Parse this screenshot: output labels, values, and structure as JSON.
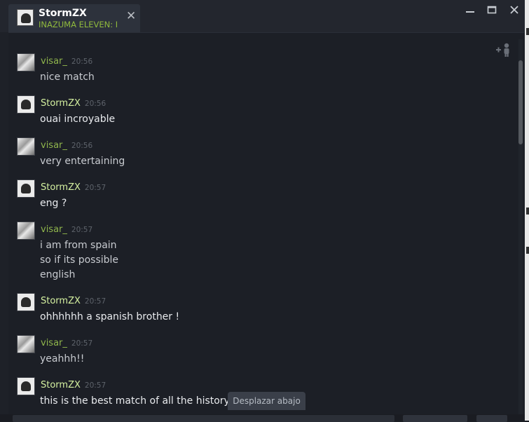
{
  "tab": {
    "name": "StormZX",
    "game": "INAZUMA ELEVEN: I"
  },
  "window_controls": {
    "minimize": "—",
    "maximize": "☐",
    "close": "✕"
  },
  "scroll_down_label": "Desplazar abajo",
  "messages": [
    {
      "author": "visar_",
      "time": "20:56",
      "lines": [
        "nice match"
      ]
    },
    {
      "author": "StormZX",
      "time": "20:56",
      "lines": [
        "ouai incroyable"
      ]
    },
    {
      "author": "visar_",
      "time": "20:56",
      "lines": [
        "very entertaining"
      ]
    },
    {
      "author": "StormZX",
      "time": "20:57",
      "lines": [
        "eng ?"
      ]
    },
    {
      "author": "visar_",
      "time": "20:57",
      "lines": [
        "i am from spain",
        "so if its possible",
        "english"
      ]
    },
    {
      "author": "StormZX",
      "time": "20:57",
      "lines": [
        "ohhhhhh a spanish brother !"
      ]
    },
    {
      "author": "visar_",
      "time": "20:57",
      "lines": [
        "yeahhh!!"
      ]
    },
    {
      "author": "StormZX",
      "time": "20:57",
      "lines": [
        "this is the best match of all the history"
      ]
    }
  ],
  "colors": {
    "game_status": "#90ba3c",
    "author_friend": "#8fb54c",
    "author_self": "#d4f0a0"
  }
}
